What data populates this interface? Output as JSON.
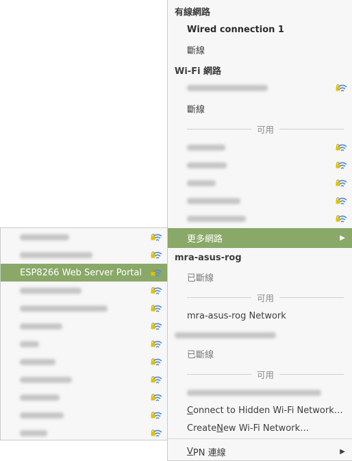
{
  "main": {
    "wired_header": "有線網路",
    "wired_connection": "Wired connection 1",
    "wired_disconnect": "斷線",
    "wifi_header": "Wi-Fi 網路",
    "wifi_disconnect": "斷線",
    "available_label": "可用",
    "more_networks": "更多網路",
    "device_header": "mra-asus-rog",
    "device_disconnected": "已斷線",
    "device_available_label": "可用",
    "device_network": "mra-asus-rog Network",
    "device2_disconnected": "已斷線",
    "device2_available_label": "可用",
    "connect_hidden_prefix": "",
    "connect_hidden_underlined": "C",
    "connect_hidden_suffix": "onnect to Hidden Wi-Fi Network…",
    "create_new_prefix": "Create ",
    "create_new_underlined": "N",
    "create_new_suffix": "ew Wi-Fi Network…",
    "vpn_underlined": "V",
    "vpn_suffix": "PN 連線"
  },
  "submenu": {
    "highlighted_network": "ESP8266 Web Server Portal"
  },
  "icons": {
    "wifi": "wifi-signal-lock-icon",
    "arrow": "chevron-right-icon"
  },
  "colors": {
    "highlight": "#8aa868",
    "menu_bg": "#f7f7f7",
    "wifi_lock": "#e0c200",
    "wifi_bars": "#5b8fd1"
  }
}
